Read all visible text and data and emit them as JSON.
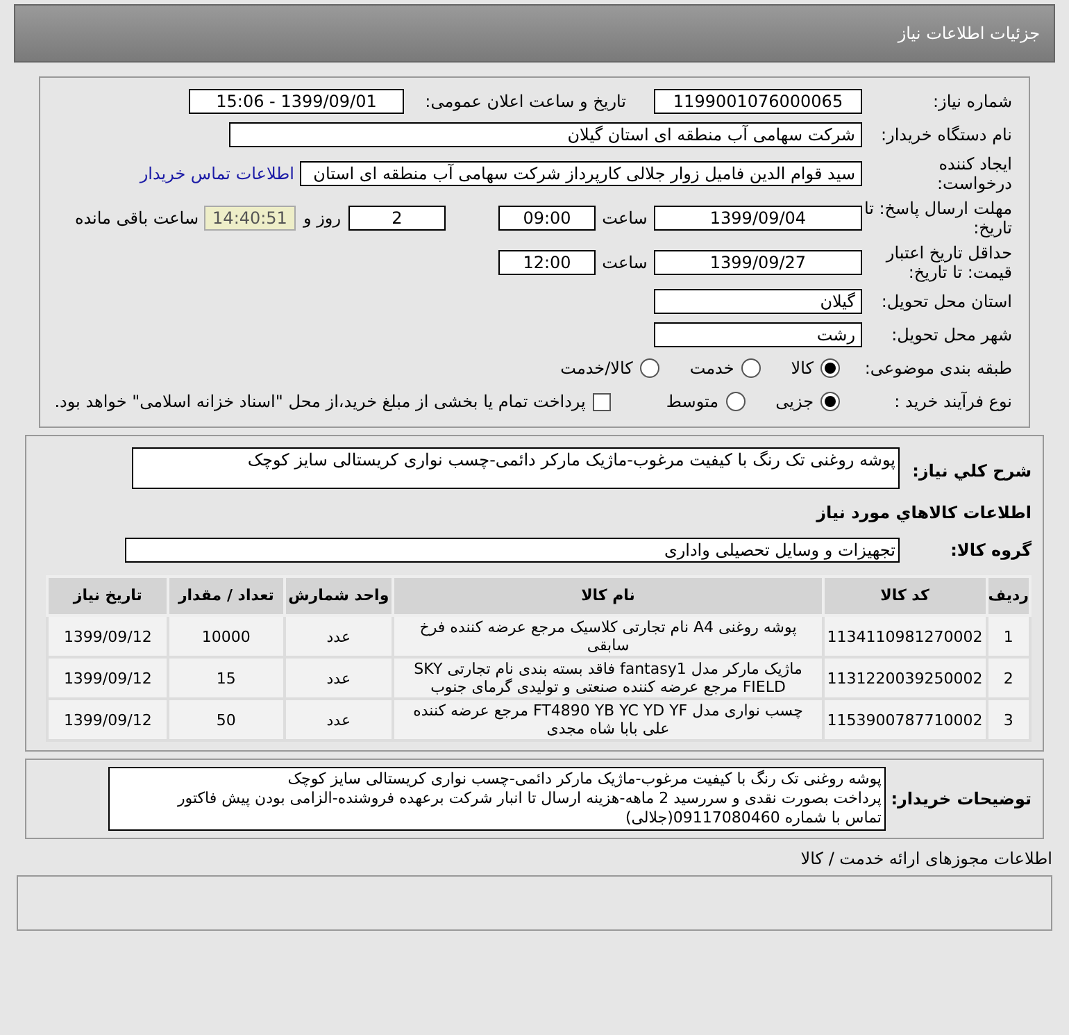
{
  "header": {
    "title": "جزئیات اطلاعات نیاز"
  },
  "details": {
    "need_number": {
      "label": "شماره نیاز:",
      "value": "1199001076000065"
    },
    "announce": {
      "label": "تاریخ و ساعت اعلان عمومی:",
      "value": "1399/09/01 - 15:06"
    },
    "buyer_org": {
      "label": "نام دستگاه خریدار:",
      "value": "شرکت سهامی آب منطقه ای استان گیلان"
    },
    "requester": {
      "label": "ایجاد کننده درخواست:",
      "value": "سید قوام الدین فامیل زوار جلالی کارپرداز شرکت سهامی آب منطقه ای استان",
      "link": "اطلاعات تماس خریدار"
    },
    "reply_deadline": {
      "label": "مهلت ارسال پاسخ: تا تاریخ:",
      "date": "1399/09/04",
      "time_label": "ساعت",
      "time": "09:00",
      "days": "2",
      "days_label": "روز و",
      "remaining": "14:40:51",
      "remaining_label": "ساعت باقی مانده"
    },
    "validity": {
      "label": "حداقل تاریخ اعتبار قیمت: تا تاریخ:",
      "date": "1399/09/27",
      "time_label": "ساعت",
      "time": "12:00"
    },
    "province": {
      "label": "استان محل تحویل:",
      "value": "گیلان"
    },
    "city": {
      "label": "شهر محل تحویل:",
      "value": "رشت"
    },
    "category": {
      "label": "طبقه بندی موضوعی:",
      "options": [
        {
          "label": "کالا",
          "selected": true
        },
        {
          "label": "خدمت",
          "selected": false
        },
        {
          "label": "کالا/خدمت",
          "selected": false
        }
      ]
    },
    "process": {
      "label": "نوع فرآیند خرید :",
      "options": [
        {
          "label": "جزیی",
          "selected": true
        },
        {
          "label": "متوسط",
          "selected": false
        }
      ],
      "payment": {
        "label": "پرداخت تمام یا بخشی از مبلغ خرید،از محل \"اسناد خزانه اسلامی\" خواهد بود.",
        "checked": false
      }
    }
  },
  "needs": {
    "summary": {
      "label": "شرح کلي نياز:",
      "value": "پوشه روغنی تک رنگ با کیفیت مرغوب-ماژیک مارکر دائمی-چسب نواری کریستالی سایز کوچک"
    },
    "section_title": "اطلاعات کالاهاي مورد نياز",
    "group": {
      "label": "گروه کالا:",
      "value": "تجهیزات و وسایل تحصیلی واداری"
    },
    "table": {
      "columns": [
        "ردیف",
        "کد کالا",
        "نام کالا",
        "واحد شمارش",
        "تعداد / مقدار",
        "تاریخ نیاز"
      ],
      "rows": [
        [
          "1",
          "1134110981270002",
          "پوشه روغنی A4 نام تجارتی کلاسیک مرجع عرضه کننده فرخ سابقی",
          "عدد",
          "10000",
          "1399/09/12"
        ],
        [
          "2",
          "1131220039250002",
          "ماژیک مارکر مدل fantasy1 فاقد بسته بندی نام تجارتی SKY FIELD مرجع عرضه کننده صنعتی و تولیدی گرمای جنوب",
          "عدد",
          "15",
          "1399/09/12"
        ],
        [
          "3",
          "1153900787710002",
          "چسب نواری مدل FT4890 YB YC YD YF مرجع عرضه کننده علی بابا شاه مجدی",
          "عدد",
          "50",
          "1399/09/12"
        ]
      ]
    }
  },
  "buyer_notes": {
    "label": "توضیحات خریدار:",
    "lines": [
      "پوشه روغنی تک رنگ با کیفیت مرغوب-ماژیک مارکر دائمی-چسب نواری کریستالی سایز کوچک",
      "پرداخت بصورت نقدی و سررسید 2 ماهه-هزینه ارسال تا انبار شرکت برعهده فروشنده-الزامی بودن پیش فاکتور",
      "تماس با شماره 09117080460(جلالی)"
    ]
  },
  "permits": {
    "title": "اطلاعات مجوزهای ارائه خدمت / کالا"
  }
}
